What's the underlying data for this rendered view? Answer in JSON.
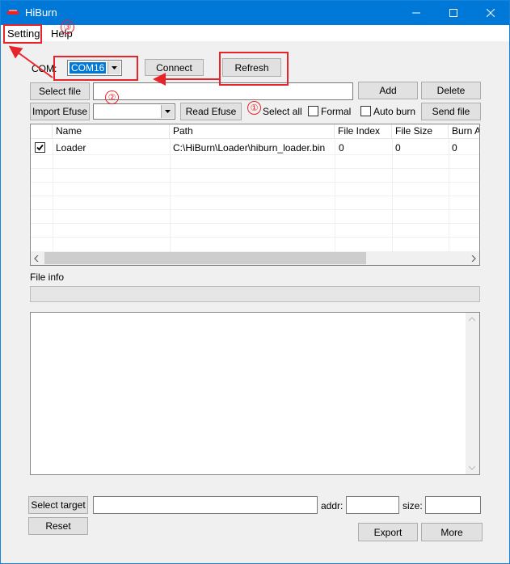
{
  "window": {
    "title": "HiBurn"
  },
  "menu": {
    "setting": "Setting",
    "help": "Help"
  },
  "com": {
    "label": "COM:",
    "value": "COM16"
  },
  "buttons": {
    "connect": "Connect",
    "refresh": "Refresh",
    "select_file": "Select file",
    "add": "Add",
    "delete": "Delete",
    "import_efuse": "Import Efuse",
    "read_efuse": "Read Efuse",
    "send_file": "Send file",
    "select_target": "Select target",
    "reset": "Reset",
    "export": "Export",
    "more": "More"
  },
  "options": {
    "select_all": "Select all",
    "formal": "Formal",
    "auto_burn": "Auto burn"
  },
  "table": {
    "columns": [
      "Name",
      "Path",
      "File Index",
      "File Size",
      "Burn A"
    ],
    "rows": [
      {
        "checked": true,
        "name": "Loader",
        "path": "C:\\HiBurn\\Loader\\hiburn_loader.bin",
        "file_index": "0",
        "file_size": "0",
        "burn_addr": "0"
      }
    ]
  },
  "file_info": {
    "label": "File info"
  },
  "target": {
    "addr_label": "addr:",
    "size_label": "size:"
  },
  "annotations": {
    "step1": "①",
    "step2": "②",
    "step3": "③"
  },
  "colors": {
    "titlebar": "#0078d7",
    "annotation": "#e8242b",
    "selection": "#0078d7"
  }
}
